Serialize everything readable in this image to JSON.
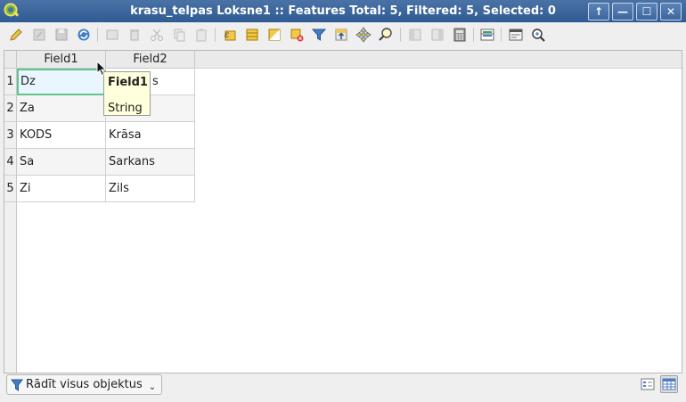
{
  "window": {
    "title": "krasu_telpas Loksne1 :: Features Total: 5, Filtered: 5, Selected: 0",
    "buttons": [
      "↑",
      "—",
      "☐",
      "✕"
    ]
  },
  "toolbar": {
    "icons": [
      "pencil-icon",
      "save-edits-icon",
      "save-icon",
      "reload-icon",
      "add-feature-icon",
      "delete-feature-icon",
      "cut-icon",
      "copy-icon",
      "paste-icon",
      "select-by-expression-icon",
      "select-all-icon",
      "invert-selection-icon",
      "deselect-all-icon",
      "filter-selection-icon",
      "move-selection-to-top-icon",
      "pan-to-selected-icon",
      "zoom-to-selected-icon",
      "new-field-icon",
      "delete-field-icon",
      "field-calculator-icon",
      "conditional-formatting-icon",
      "dock-icon",
      "actions-icon"
    ]
  },
  "table": {
    "columns": [
      "Field1",
      "Field2"
    ],
    "rows": [
      {
        "num": "1",
        "field1": "Dz",
        "field2": "s"
      },
      {
        "num": "2",
        "field1": "Za",
        "field2": ""
      },
      {
        "num": "3",
        "field1": "KODS",
        "field2": "Krāsa"
      },
      {
        "num": "4",
        "field1": "Sa",
        "field2": "Sarkans"
      },
      {
        "num": "5",
        "field1": "Zi",
        "field2": "Zils"
      }
    ]
  },
  "tooltip": {
    "title": "Field1",
    "type": "String"
  },
  "footer": {
    "filter_label": "Rādīt visus objektus",
    "dropdown_arrow": "⌄"
  },
  "colors": {
    "titlebar": "#3b659c",
    "selected_cell_border": "#5ec58b",
    "tooltip_bg": "#ffffdc"
  }
}
